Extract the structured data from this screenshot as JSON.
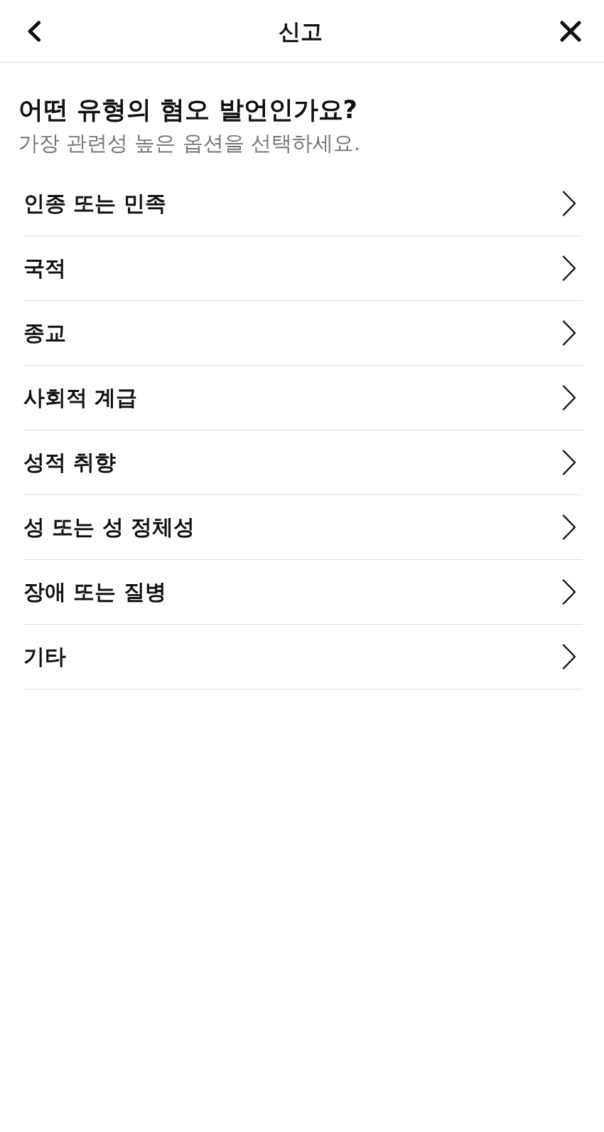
{
  "header": {
    "title": "신고"
  },
  "question": {
    "title": "어떤 유형의 혐오 발언인가요?",
    "subtitle": "가장 관련성 높은 옵션을 선택하세요."
  },
  "options": [
    {
      "label": "인종 또는 민족"
    },
    {
      "label": "국적"
    },
    {
      "label": "종교"
    },
    {
      "label": "사회적 계급"
    },
    {
      "label": "성적 취향"
    },
    {
      "label": "성 또는 성 정체성"
    },
    {
      "label": "장애 또는 질병"
    },
    {
      "label": "기타"
    }
  ]
}
